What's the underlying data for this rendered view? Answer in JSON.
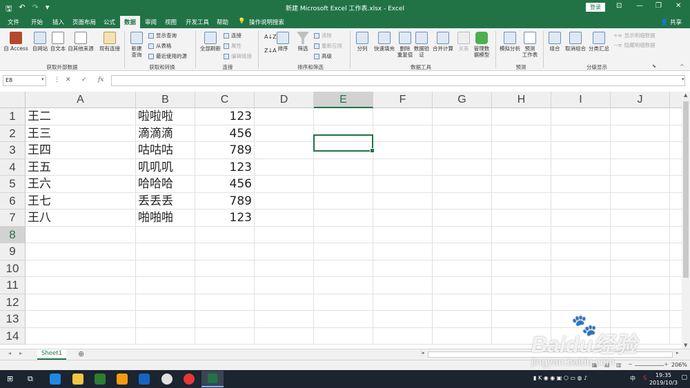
{
  "window": {
    "title": "新建 Microsoft Excel 工作表.xlsx  -  Excel",
    "login": "登录"
  },
  "menu": {
    "tabs": [
      "文件",
      "开始",
      "插入",
      "页面布局",
      "公式",
      "数据",
      "审阅",
      "视图",
      "开发工具",
      "帮助"
    ],
    "active": "数据",
    "tell_me": "操作说明搜索",
    "share": "共享"
  },
  "ribbon": {
    "ext": {
      "access": "自 Access",
      "web": "自网站",
      "text": "自文本",
      "other": "自其他来源",
      "existing": "现有连接",
      "group": "获取外部数据"
    },
    "transform": {
      "newquery": "新建\n查询",
      "showquery": "显示查询",
      "fromtable": "从表格",
      "recent": "最近使用的源",
      "group": "获取和转换"
    },
    "conn": {
      "refresh": "全部刷新",
      "connections": "连接",
      "properties": "属性",
      "editlinks": "编辑链接",
      "group": "连接"
    },
    "sort": {
      "sort": "排序",
      "filter": "筛选",
      "clear": "清除",
      "reapply": "重新应用",
      "advanced": "高级",
      "group": "排序和筛选"
    },
    "tools": {
      "split": "分列",
      "flash": "快速填充",
      "dedupe": "删除\n重复值",
      "validate": "数据验\n证",
      "consolidate": "合并计算",
      "relations": "关系",
      "model": "管理数\n据模型",
      "group": "数据工具"
    },
    "forecast": {
      "whatif": "模拟分析",
      "sheet": "预测\n工作表",
      "group": "预测"
    },
    "outline": {
      "grp": "组合",
      "ungrp": "取消组合",
      "subtotal": "分类汇总",
      "show": "显示明细数据",
      "hide": "隐藏明细数据",
      "group": "分级显示"
    }
  },
  "formula_bar": {
    "name_box": "E8",
    "fx": "fx",
    "value": ""
  },
  "sheet": {
    "columns": [
      "A",
      "B",
      "C",
      "D",
      "E",
      "F",
      "G",
      "H",
      "I",
      "J"
    ],
    "selected_col": "E",
    "selected_row": "8",
    "rows": [
      {
        "n": "1",
        "a": "王二",
        "b": "啦啦啦",
        "c": "123"
      },
      {
        "n": "2",
        "a": "王三",
        "b": "滴滴滴",
        "c": "456"
      },
      {
        "n": "3",
        "a": "王四",
        "b": "咕咕咕",
        "c": "789"
      },
      {
        "n": "4",
        "a": "王五",
        "b": "叽叽叽",
        "c": "123"
      },
      {
        "n": "5",
        "a": "王六",
        "b": "哈哈哈",
        "c": "456"
      },
      {
        "n": "6",
        "a": "王七",
        "b": "丢丢丢",
        "c": "789"
      },
      {
        "n": "7",
        "a": "王八",
        "b": "啪啪啪",
        "c": "123"
      },
      {
        "n": "8",
        "a": "",
        "b": "",
        "c": ""
      },
      {
        "n": "9",
        "a": "",
        "b": "",
        "c": ""
      },
      {
        "n": "10",
        "a": "",
        "b": "",
        "c": ""
      },
      {
        "n": "11",
        "a": "",
        "b": "",
        "c": ""
      },
      {
        "n": "12",
        "a": "",
        "b": "",
        "c": ""
      },
      {
        "n": "13",
        "a": "",
        "b": "",
        "c": ""
      },
      {
        "n": "14",
        "a": "",
        "b": "",
        "c": ""
      }
    ]
  },
  "sheet_tabs": [
    "Sheet1"
  ],
  "status": {
    "zoom": "206%"
  },
  "taskbar": {
    "time": "19:35",
    "date": "2019/10/3",
    "ime": "中"
  },
  "watermark": {
    "brand": "Baidu经验",
    "url": "jingyan.baidu.com"
  },
  "colors": {
    "excel_green": "#217346",
    "taskbar": "#1c2430"
  }
}
